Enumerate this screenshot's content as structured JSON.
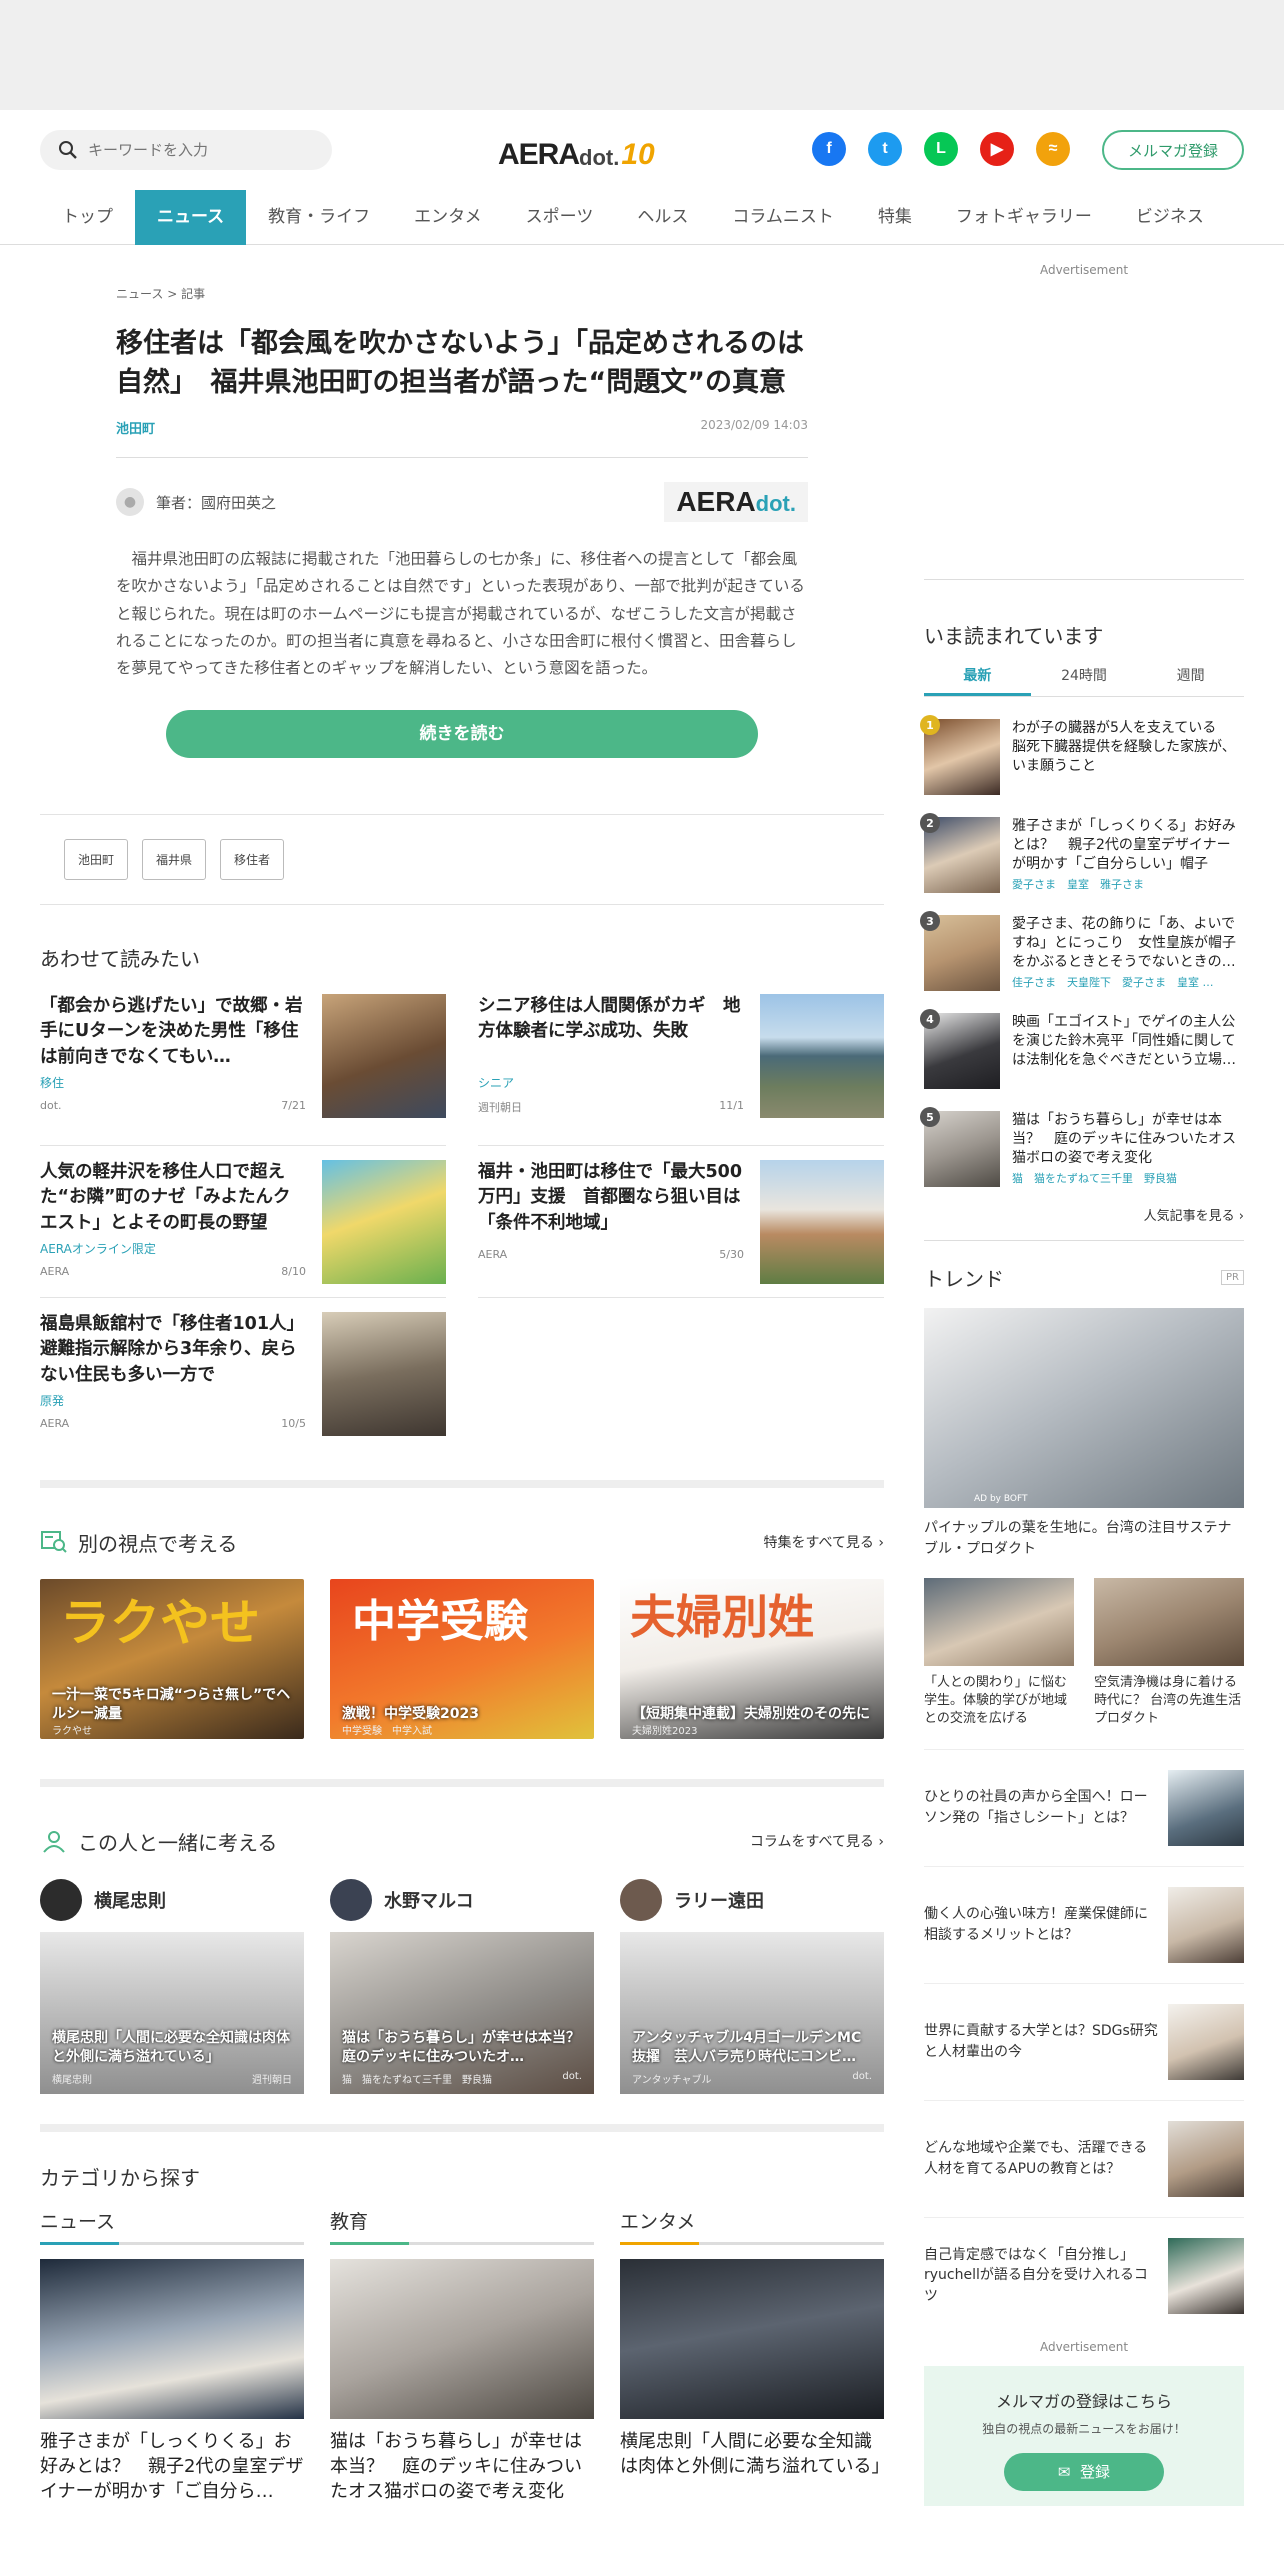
{
  "header": {
    "search_placeholder": "キーワードを入力",
    "logo_main": "AERA",
    "logo_dot": "dot.",
    "logo_badge": "10",
    "mail_button": "メルマガ登録",
    "social": [
      {
        "name": "facebook",
        "glyph": "f",
        "color": "#1877f2"
      },
      {
        "name": "twitter",
        "glyph": "t",
        "color": "#1d9bf0"
      },
      {
        "name": "line",
        "glyph": "L",
        "color": "#06c755"
      },
      {
        "name": "youtube",
        "glyph": "▶",
        "color": "#e62117"
      },
      {
        "name": "rss",
        "glyph": "≈",
        "color": "#f2a20c"
      }
    ]
  },
  "nav": [
    "トップ",
    "ニュース",
    "教育・ライフ",
    "エンタメ",
    "スポーツ",
    "ヘルス",
    "コラムニスト",
    "特集",
    "フォトギャラリー",
    "ビジネス"
  ],
  "article": {
    "breadcrumb": "ニュース > 記事",
    "title": "移住者は「都会風を吹かさないよう」「品定めされるのは自然」　福井県池田町の担当者が語った“問題文”の真意",
    "tag": "池田町",
    "date": "2023/02/09 14:03",
    "author": "筆者：國府田英之",
    "author_logo": "AERA",
    "author_logo_dot": "dot.",
    "lead": "福井県池田町の広報誌に掲載された「池田暮らしの七か条」に、移住者への提言として「都会風を吹かさないよう」「品定めされることは自然です」といった表現があり、一部で批判が起きていると報じられた。現在は町のホームページにも提言が掲載されているが、なぜこうした文言が掲載されることになったのか。町の担当者に真意を尋ねると、小さな田舎町に根付く慣習と、田舎暮らしを夢見てやってきた移住者とのギャップを解消したい、という意図を語った。",
    "read_more": "続きを読む",
    "tags": [
      "池田町",
      "福井県",
      "移住者"
    ]
  },
  "related": {
    "title": "あわせて読みたい",
    "items": [
      {
        "headline": "「都会から逃げたい」で故郷・岩手にUターンを決めた男性「移住は前向きでなくてもい…",
        "category": "移住",
        "source": "dot.",
        "date": "7/21"
      },
      {
        "headline": "シニア移住は人間関係がカギ　地方体験者に学ぶ成功、失敗",
        "category": "シニア",
        "source": "週刊朝日",
        "date": "11/1"
      },
      {
        "headline": "人気の軽井沢を移住人口で超えた“お隣”町のナゼ「みよたんクエスト」とよその町長の野望",
        "category": "AERAオンライン限定",
        "source": "AERA",
        "date": "8/10"
      },
      {
        "headline": "福井・池田町は移住で「最大500万円」支援　首都圏なら狙い目は「条件不利地域」",
        "category": "",
        "source": "AERA",
        "date": "5/30"
      },
      {
        "headline": "福島県飯舘村で「移住者101人」　避難指示解除から3年余り、戻らない住民も多い一方で",
        "category": "原発",
        "source": "AERA",
        "date": "10/5"
      }
    ]
  },
  "viewpoint": {
    "title": "別の視点で考える",
    "more": "特集をすべて見る",
    "cards": [
      {
        "caption": "一汁一菜で5キロ減“つらさ無し”でヘルシー減量",
        "sub": "ラクやせ",
        "overlay": "ラクやせ"
      },
      {
        "caption": "激戦！中学受験2023",
        "sub": "中学受験　中学入試",
        "overlay": "中学受験"
      },
      {
        "caption": "【短期集中連載】夫婦別姓のその先に",
        "sub": "夫婦別姓2023",
        "overlay": "夫婦別姓"
      }
    ]
  },
  "people": {
    "title": "この人と一緒に考える",
    "more": "コラムをすべて見る",
    "items": [
      {
        "name": "横尾忠則",
        "caption": "横尾忠則「人間に必要な全知識は肉体と外側に満ち溢れている」",
        "left": "横尾忠則",
        "right": "週刊朝日"
      },
      {
        "name": "水野マルコ",
        "caption": "猫は「おうち暮らし」が幸せは本当？　庭のデッキに住みついたオ…",
        "left": "猫　猫をたずねて三千里　野良猫",
        "right": "dot."
      },
      {
        "name": "ラリー遠田",
        "caption": "アンタッチャブル4月ゴールデンMC抜擢　芸人バラ売り時代にコンビ…",
        "left": "アンタッチャブル",
        "right": "dot."
      }
    ]
  },
  "categories": {
    "title": "カテゴリから探す",
    "items": [
      {
        "name": "ニュース",
        "caption": "雅子さまが「しっくりくる」お好みとは？　親子2代の皇室デザイナーが明かす「ご自分ら…",
        "color": "#2aa1b6"
      },
      {
        "name": "教育",
        "caption": "猫は「おうち暮らし」が幸せは本当？　庭のデッキに住みついたオス猫ボロの姿で考え変化",
        "color": "#4cb788"
      },
      {
        "name": "エンタメ",
        "caption": "横尾忠則「人間に必要な全知識は肉体と外側に満ち溢れている」",
        "color": "#f0a400"
      }
    ]
  },
  "sidebar": {
    "ad_label": "Advertisement",
    "ranking_title": "いま読まれています",
    "tabs": [
      "最新",
      "24時間",
      "週間"
    ],
    "ranking": [
      {
        "rank": "1",
        "text": "わが子の臓器が5人を支えている　脳死下臓器提供を経験した家族が、いま願うこと",
        "tags": ""
      },
      {
        "rank": "2",
        "text": "雅子さまが「しっくりくる」お好みとは？　親子2代の皇室デザイナーが明かす「ご自分らしい」帽子",
        "tags": "愛子さま　皇室　雅子さま"
      },
      {
        "rank": "3",
        "text": "愛子さま、花の飾りに「あ、よいですね」とにっこり　女性皇族が帽子をかぶるときとそうでないときの…",
        "tags": "佳子さま　天皇陛下　愛子さま　皇室 …"
      },
      {
        "rank": "4",
        "text": "映画「エゴイスト」でゲイの主人公を演じた鈴木亮平「同性婚に関しては法制化を急ぐべきだという立場…",
        "tags": ""
      },
      {
        "rank": "5",
        "text": "猫は「おうち暮らし」が幸せは本当？　庭のデッキに住みついたオス猫ボロの姿で考え変化",
        "tags": "猫　猫をたずねて三千里　野良猫"
      }
    ],
    "ranking_more": "人気記事を見る",
    "trend_title": "トレンド",
    "pr": "PR",
    "trend_ad": "AD by BOFT",
    "trend_main": "パイナップルの葉を生地に。台湾の注目サステナブル・プロダクト",
    "trend_pair": [
      {
        "caption": "「人との関わり」に悩む学生。体験的学びが地域との交流を広げる"
      },
      {
        "caption": "空気清浄機は身に着ける時代に？ 台湾の先進生活プロダクト"
      }
    ],
    "trend_list": [
      {
        "caption": "ひとりの社員の声から全国へ！ローソン発の「指さしシート」とは？"
      },
      {
        "caption": "働く人の心強い味方！産業保健師に相談するメリットとは？"
      },
      {
        "caption": "世界に貢献する大学とは？SDGs研究と人材輩出の今"
      },
      {
        "caption": "どんな地域や企業でも、活躍できる人材を育てるAPUの教育とは？"
      },
      {
        "caption": "自己肯定感ではなく「自分推し」ryuchellが語る自分を受け入れるコツ"
      }
    ],
    "ad_label2": "Advertisement",
    "mail_t1": "メルマガの登録はこちら",
    "mail_t2": "独自の視点の最新ニュースをお届け！",
    "mail_btn": "登録"
  }
}
